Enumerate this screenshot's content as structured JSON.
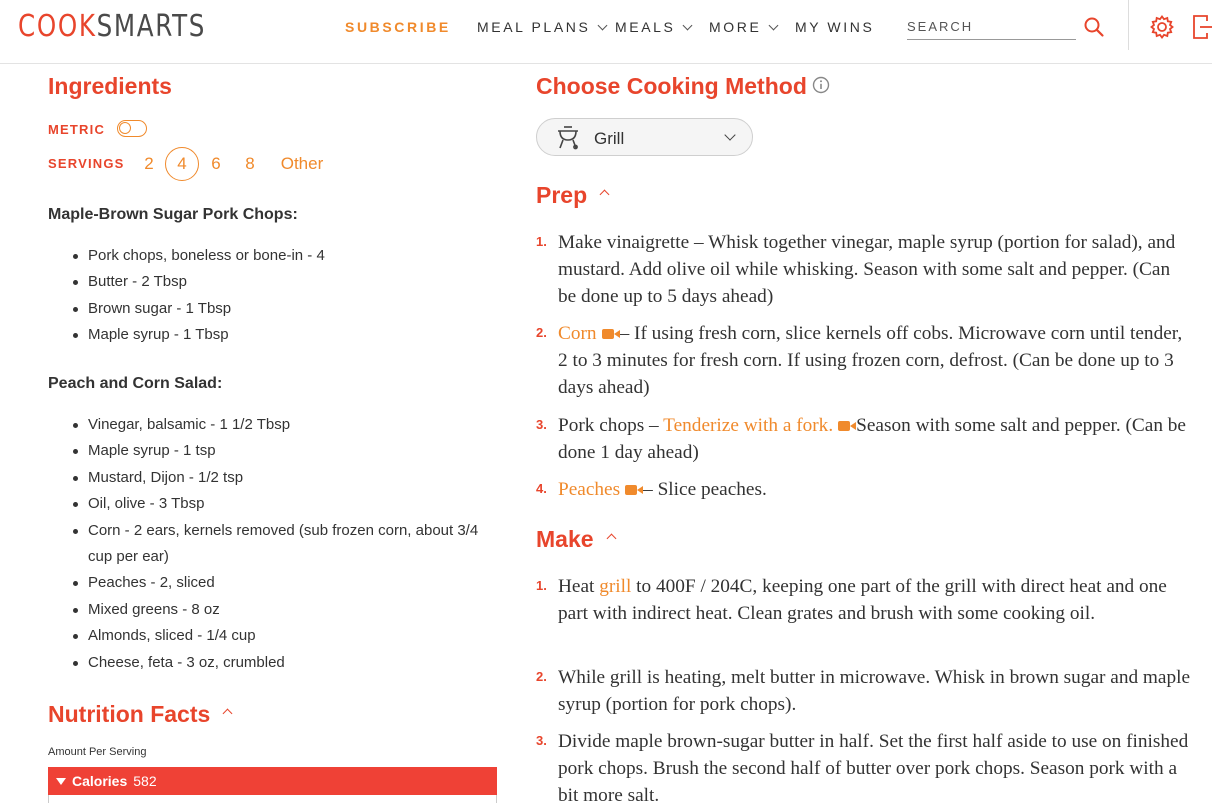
{
  "header": {
    "logo_left": "COOK",
    "logo_right": "SMARTS",
    "nav": [
      {
        "label": "SUBSCRIBE"
      },
      {
        "label": "MEAL PLANS"
      },
      {
        "label": "MEALS"
      },
      {
        "label": "MORE"
      },
      {
        "label": "MY WINS"
      }
    ],
    "search_placeholder": "SEARCH"
  },
  "ingredients": {
    "title": "Ingredients",
    "metric_label": "METRIC",
    "metric_on": false,
    "servings_label": "SERVINGS",
    "servings": [
      "2",
      "4",
      "6",
      "8",
      "Other"
    ],
    "servings_selected": "4",
    "groups": [
      {
        "title": "Maple-Brown Sugar Pork Chops:",
        "items": [
          "Pork chops, boneless or bone-in - 4",
          "Butter - 2 Tbsp",
          "Brown sugar - 1 Tbsp",
          "Maple syrup - 1 Tbsp"
        ]
      },
      {
        "title": "Peach and Corn Salad:",
        "items": [
          "Vinegar, balsamic - 1 1/2 Tbsp",
          "Maple syrup - 1 tsp",
          "Mustard, Dijon - 1/2 tsp",
          "Oil, olive - 3 Tbsp",
          "Corn - 2 ears, kernels removed (sub frozen corn, about 3/4 cup per ear)",
          "Peaches - 2, sliced",
          "Mixed greens - 8 oz",
          "Almonds, sliced - 1/4 cup",
          "Cheese, feta - 3 oz, crumbled"
        ]
      }
    ]
  },
  "nutrition": {
    "title": "Nutrition Facts",
    "amount_label": "Amount Per Serving",
    "calories_label": "Calories",
    "calories_value": "582"
  },
  "method": {
    "title": "Choose Cooking Method",
    "selected": "Grill"
  },
  "prep": {
    "title": "Prep",
    "steps": [
      {
        "num": "1.",
        "text": "Make vinaigrette – Whisk together vinegar, maple syrup (portion for salad), and mustard. Add olive oil while whisking. Season with some salt and pepper. (Can be done up to 5 days ahead)"
      },
      {
        "num": "2.",
        "link": "Corn",
        "text": "– If using fresh corn, slice kernels off cobs. Microwave corn until tender, 2 to 3 minutes for fresh corn. If using frozen corn, defrost. (Can be done up to 3 days ahead)"
      },
      {
        "num": "3.",
        "pre": "Pork chops – ",
        "link": "Tenderize with a fork.",
        "text": "Season with some salt and pepper. (Can be done 1 day ahead)"
      },
      {
        "num": "4.",
        "link": "Peaches",
        "text": "– Slice peaches."
      }
    ]
  },
  "make": {
    "title": "Make",
    "steps": [
      {
        "num": "1.",
        "pre": "Heat ",
        "link": "grill",
        "text": " to 400F / 204C, keeping one part of the grill with direct heat and one part with indirect heat. Clean grates and brush with some cooking oil."
      },
      {
        "num": "2.",
        "text": "While grill is heating, melt butter in microwave. Whisk in brown sugar and maple syrup (portion for pork chops)."
      },
      {
        "num": "3.",
        "text": "Divide maple brown-sugar butter in half. Set the first half aside to use on finished pork chops. Brush the second half of butter over pork chops. Season pork with a bit more salt."
      }
    ]
  },
  "colors": {
    "brand_red": "#e8452c",
    "accent_orange": "#f08a2c",
    "calorie_bar": "#ef4136"
  }
}
